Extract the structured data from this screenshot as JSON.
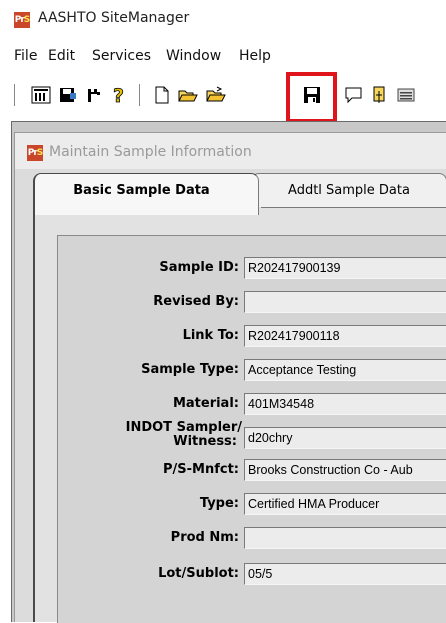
{
  "app": {
    "title": "AASHTO SiteManager",
    "icon_text": "PrS",
    "accent_color": "#c9462b"
  },
  "menu": [
    "File",
    "Edit",
    "Services",
    "Window",
    "Help"
  ],
  "toolbar": {
    "buttons": [
      "report-icon",
      "disk-rack-icon",
      "tree-icon",
      "help-icon",
      "new-document-icon",
      "open-folder-icon",
      "open-folder-alt-icon",
      "save-icon",
      "comment-icon",
      "attach-icon",
      "list-icon"
    ],
    "highlighted": "save-icon",
    "highlight_color": "#e0151c"
  },
  "window": {
    "title": "Maintain Sample Information"
  },
  "tabs": {
    "active": "Basic Sample Data",
    "inactive": "Addtl Sample Data"
  },
  "form": {
    "sample_id_label": "Sample ID:",
    "sample_id_value": "R202417900139",
    "revised_by_label": "Revised By:",
    "revised_by_value": "",
    "link_to_label": "Link To:",
    "link_to_value": "R202417900118",
    "sample_type_label": "Sample Type:",
    "sample_type_value": "Acceptance Testing",
    "material_label": "Material:",
    "material_value": "401M34548",
    "sampler_label_1": "INDOT Sampler/",
    "sampler_label_2": "Witness:",
    "sampler_value": "d20chry",
    "ps_mnfct_label": "P/S-Mnfct:",
    "ps_mnfct_value": "Brooks Construction Co - Aub",
    "type_label": "Type:",
    "type_value": "Certified HMA Producer",
    "prod_nm_label": "Prod Nm:",
    "prod_nm_value": "",
    "lot_label": "Lot/Sublot:",
    "lot_value": "05/5"
  }
}
